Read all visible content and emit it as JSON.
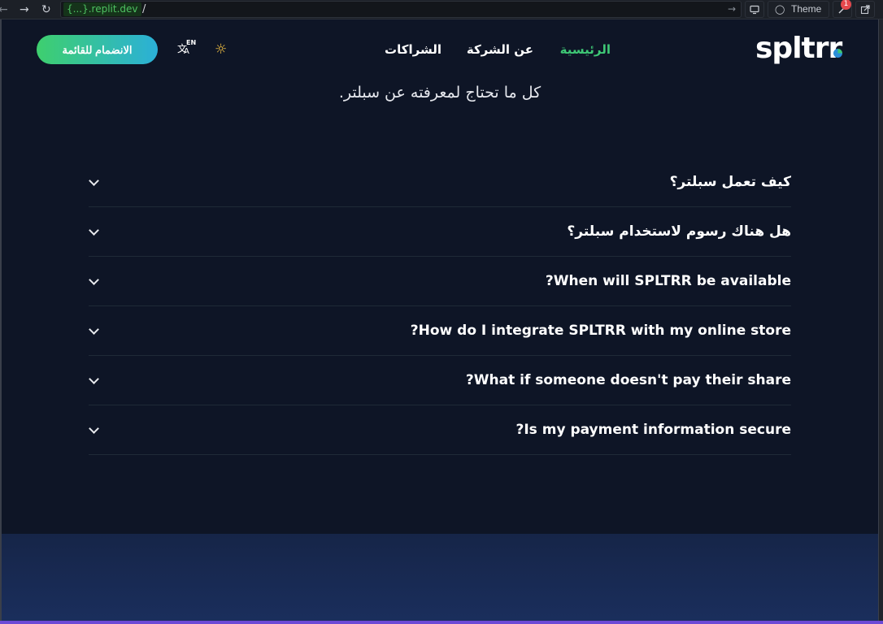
{
  "browser": {
    "url_domain": "{...}.replit.dev",
    "url_path": "/",
    "theme_label": "Theme",
    "notification_count": "1"
  },
  "header": {
    "logo": "spltrr",
    "nav": {
      "home": "الرئيسية",
      "about": "عن الشركة",
      "partnerships": "الشراكات"
    },
    "lang_code": "EN",
    "cta": "الانضمام للقائمة"
  },
  "intro": "كل ما تحتاج لمعرفته عن سبلتر.",
  "faq": [
    {
      "q": "كيف تعمل سبلتر؟"
    },
    {
      "q": "هل هناك رسوم لاستخدام سبلتر؟"
    },
    {
      "q": "?When will SPLTRR be available"
    },
    {
      "q": "?How do I integrate SPLTRR with my online store"
    },
    {
      "q": "?What if someone doesn't pay their share"
    },
    {
      "q": "?Is my payment information secure"
    }
  ],
  "colors": {
    "background": "#0e1526",
    "accent_green": "#3ec775",
    "cta_gradient_start": "#3ecf6e",
    "cta_gradient_end": "#2bb0d8",
    "sun_icon": "#f5c242",
    "band": "#1a2e5c"
  }
}
